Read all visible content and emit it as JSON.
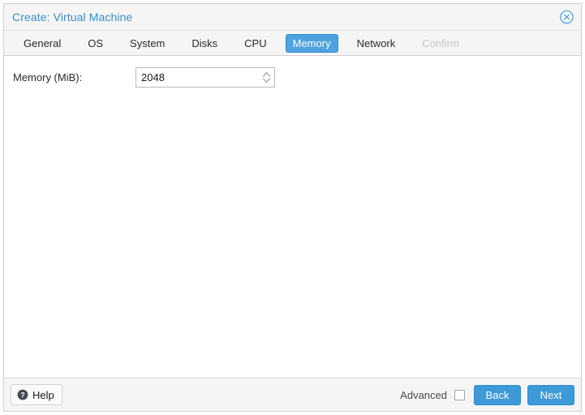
{
  "window": {
    "title": "Create: Virtual Machine",
    "close_icon": "close-circle-icon"
  },
  "tabs": [
    {
      "label": "General",
      "state": "normal"
    },
    {
      "label": "OS",
      "state": "normal"
    },
    {
      "label": "System",
      "state": "normal"
    },
    {
      "label": "Disks",
      "state": "normal"
    },
    {
      "label": "CPU",
      "state": "normal"
    },
    {
      "label": "Memory",
      "state": "active"
    },
    {
      "label": "Network",
      "state": "normal"
    },
    {
      "label": "Confirm",
      "state": "disabled"
    }
  ],
  "form": {
    "memory": {
      "label": "Memory (MiB):",
      "value": "2048",
      "placeholder": "",
      "stepper_icon": "spinner-arrows-icon"
    }
  },
  "footer": {
    "help_label": "Help",
    "help_icon": "question-circle-icon",
    "advanced_label": "Advanced",
    "advanced_checked": false,
    "back_label": "Back",
    "next_label": "Next"
  },
  "colors": {
    "accent": "#3c9ad9",
    "tab_active": "#4ea2df",
    "title_text": "#3c8dc5",
    "header_bg": "#f5f5f5",
    "body_bg": "#ffffff",
    "disabled_text": "#c6c6c6"
  }
}
